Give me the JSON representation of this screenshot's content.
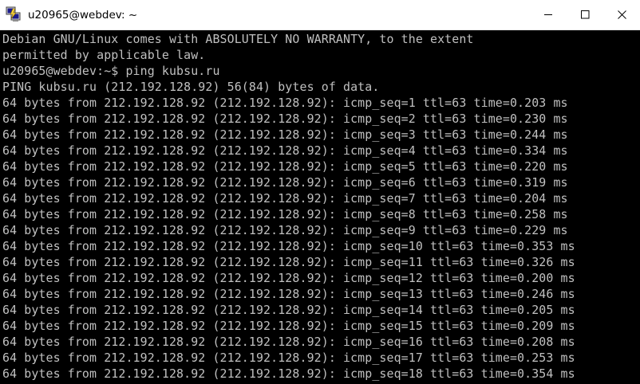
{
  "window": {
    "title": "u20965@webdev: ~",
    "minimize_label": "Minimize",
    "maximize_label": "Maximize",
    "close_label": "Close"
  },
  "colors": {
    "terminal_bg": "#000000",
    "terminal_fg": "#c0c0c0",
    "titlebar_bg": "#ffffff"
  },
  "terminal": {
    "lines": [
      "Debian GNU/Linux comes with ABSOLUTELY NO WARRANTY, to the extent",
      "permitted by applicable law.",
      "u20965@webdev:~$ ping kubsu.ru",
      "PING kubsu.ru (212.192.128.92) 56(84) bytes of data.",
      "64 bytes from 212.192.128.92 (212.192.128.92): icmp_seq=1 ttl=63 time=0.203 ms",
      "64 bytes from 212.192.128.92 (212.192.128.92): icmp_seq=2 ttl=63 time=0.230 ms",
      "64 bytes from 212.192.128.92 (212.192.128.92): icmp_seq=3 ttl=63 time=0.244 ms",
      "64 bytes from 212.192.128.92 (212.192.128.92): icmp_seq=4 ttl=63 time=0.334 ms",
      "64 bytes from 212.192.128.92 (212.192.128.92): icmp_seq=5 ttl=63 time=0.220 ms",
      "64 bytes from 212.192.128.92 (212.192.128.92): icmp_seq=6 ttl=63 time=0.319 ms",
      "64 bytes from 212.192.128.92 (212.192.128.92): icmp_seq=7 ttl=63 time=0.204 ms",
      "64 bytes from 212.192.128.92 (212.192.128.92): icmp_seq=8 ttl=63 time=0.258 ms",
      "64 bytes from 212.192.128.92 (212.192.128.92): icmp_seq=9 ttl=63 time=0.229 ms",
      "64 bytes from 212.192.128.92 (212.192.128.92): icmp_seq=10 ttl=63 time=0.353 ms",
      "64 bytes from 212.192.128.92 (212.192.128.92): icmp_seq=11 ttl=63 time=0.326 ms",
      "64 bytes from 212.192.128.92 (212.192.128.92): icmp_seq=12 ttl=63 time=0.200 ms",
      "64 bytes from 212.192.128.92 (212.192.128.92): icmp_seq=13 ttl=63 time=0.246 ms",
      "64 bytes from 212.192.128.92 (212.192.128.92): icmp_seq=14 ttl=63 time=0.205 ms",
      "64 bytes from 212.192.128.92 (212.192.128.92): icmp_seq=15 ttl=63 time=0.209 ms",
      "64 bytes from 212.192.128.92 (212.192.128.92): icmp_seq=16 ttl=63 time=0.208 ms",
      "64 bytes from 212.192.128.92 (212.192.128.92): icmp_seq=17 ttl=63 time=0.253 ms",
      "64 bytes from 212.192.128.92 (212.192.128.92): icmp_seq=18 ttl=63 time=0.354 ms"
    ]
  }
}
